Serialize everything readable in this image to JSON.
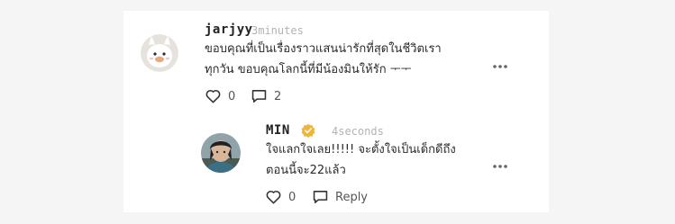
{
  "comment": {
    "username": "jarjyy",
    "timestamp": "3minutes",
    "text_line1": "ขอบคุณที่เป็นเรื่องราวแสนน่ารักที่สุดในชีวิตเรา",
    "text_line2": "ทุกวัน ขอบคุณโลกนี้ที่มีน้องมินให้รัก ᅮᅮ",
    "likes": "0",
    "replies": "2",
    "avatar_icon": "white-cartoon-avatar-icon"
  },
  "reply": {
    "username": "MIN",
    "verified_icon": "verified-badge-icon",
    "timestamp": "4seconds",
    "text_line1": "ใจแลกใจเลย!!!!! จะตั้งใจเป็นเด็กดีถึง",
    "text_line2": "ตอนนี้จะ22แล้ว",
    "likes": "0",
    "reply_label": "Reply",
    "avatar_icon": "photo-avatar-icon"
  },
  "colors": {
    "background": "#f5f5f5",
    "card": "#ffffff",
    "text": "#2b2b2b",
    "muted": "#b3b3b3",
    "badge": "#f0b43a"
  }
}
